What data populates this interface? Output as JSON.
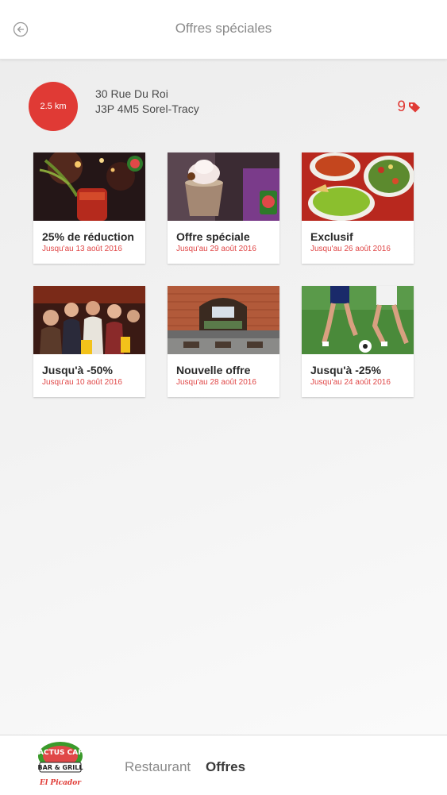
{
  "header": {
    "title": "Offres spéciales",
    "back_icon": "back-arrow-icon"
  },
  "store": {
    "distance": "2.5 km",
    "address_line1": "30 Rue Du Roi",
    "address_line2": "J3P 4M5 Sorel-Tracy",
    "offer_count": "9",
    "offer_icon": "tag-icon"
  },
  "offers": [
    {
      "title": "25% de réduction",
      "date": "Jusqu'au 13 août 2016",
      "image": "cocktail-bar-photo"
    },
    {
      "title": "Offre spéciale",
      "date": "Jusqu'au 29 août 2016",
      "image": "dessert-drink-photo"
    },
    {
      "title": "Exclusif",
      "date": "Jusqu'au 26 août 2016",
      "image": "guacamole-salsa-photo"
    },
    {
      "title": "Jusqu'à -50%",
      "date": "Jusqu'au 10 août 2016",
      "image": "friends-cheering-photo"
    },
    {
      "title": "Nouvelle offre",
      "date": "Jusqu'au 28 août 2016",
      "image": "restaurant-interior-photo"
    },
    {
      "title": "Jusqu'à -25%",
      "date": "Jusqu'au 24 août 2016",
      "image": "soccer-players-photo"
    }
  ],
  "bottom_nav": {
    "logo_text_top": "CACTUS CAFE",
    "logo_text_mid": "BAR & GRILL",
    "logo_text_bottom": "El Picador",
    "items": [
      "Restaurant",
      "Offres"
    ],
    "active": "Offres"
  },
  "colors": {
    "accent": "#e03a35",
    "date_red": "#e04848"
  }
}
